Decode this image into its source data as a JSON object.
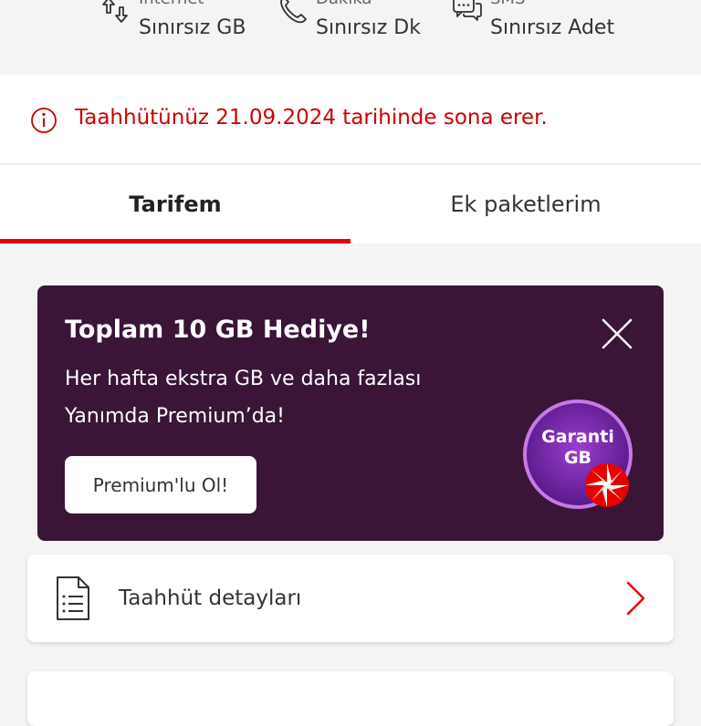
{
  "summary": {
    "internet": {
      "label": "İnternet",
      "value": "Sınırsız GB",
      "icon": "data-transfer-icon"
    },
    "dakika": {
      "label": "Dakika",
      "value": "Sınırsız Dk",
      "icon": "phone-icon"
    },
    "sms": {
      "label": "SMS",
      "value": "Sınırsız Adet",
      "icon": "chat-bubbles-icon"
    }
  },
  "notice": {
    "icon": "info-icon",
    "text": "Taahhütünüz 21.09.2024 tarihinde sona erer.",
    "color": "#cc0000"
  },
  "tabs": [
    {
      "label": "Tarifem",
      "active": true
    },
    {
      "label": "Ek paketlerim",
      "active": false
    }
  ],
  "promo": {
    "title": "Toplam 10 GB Hediye!",
    "description_line1": "Her hafta ekstra GB ve daha fazlası",
    "description_line2": "Yanımda Premium’da!",
    "cta_label": "Premium'lu Ol!",
    "badge_line1": "Garanti",
    "badge_line2": "GB",
    "background": "#3a1537"
  },
  "list": {
    "taahhut": {
      "label": "Taahhüt detayları",
      "icon": "document-icon"
    }
  },
  "colors": {
    "accent": "#e60000",
    "background": "#f4f4f4"
  }
}
